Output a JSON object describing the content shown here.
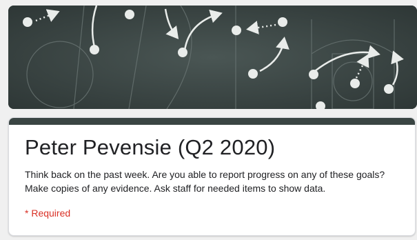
{
  "colors": {
    "theme": "#3a4543",
    "background": "#f0f0f0",
    "card": "#ffffff",
    "required": "#d93025"
  },
  "banner": {
    "image": "chalkboard-basketball-play-diagram"
  },
  "form": {
    "title": "Peter Pevensie (Q2 2020)",
    "description": "Think back on the past week. Are you able to report progress on any of these goals? Make copies of any evidence. Ask staff for needed items to show data.",
    "required_label": "* Required"
  }
}
